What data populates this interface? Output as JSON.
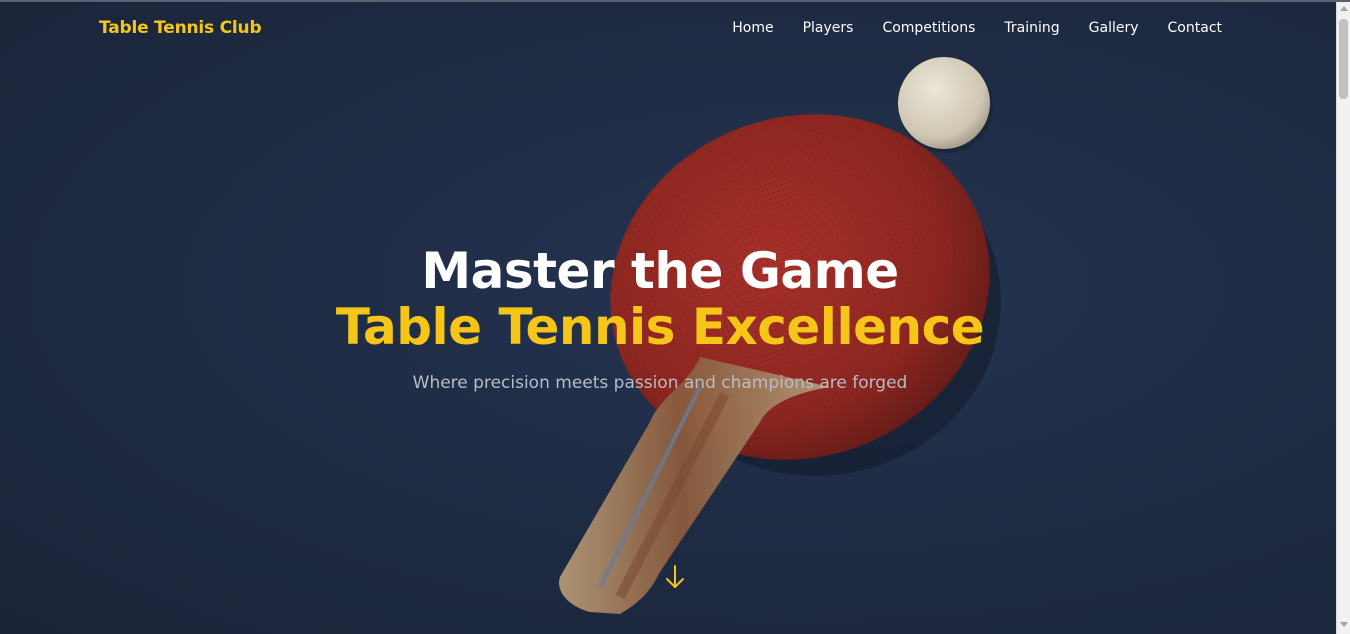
{
  "brand": {
    "name": "Table Tennis Club"
  },
  "nav": {
    "items": [
      {
        "label": "Home"
      },
      {
        "label": "Players"
      },
      {
        "label": "Competitions"
      },
      {
        "label": "Training"
      },
      {
        "label": "Gallery"
      },
      {
        "label": "Contact"
      }
    ]
  },
  "hero": {
    "title_line1": "Master the Game",
    "title_line2": "Table Tennis Excellence",
    "tagline": "Where precision meets passion and champions are forged",
    "scroll_icon": "arrow-down-icon",
    "background_image": "paddle-and-ball-photo"
  },
  "colors": {
    "accent": "#f5c518",
    "background": "#1e2a3f",
    "text": "#ffffff",
    "muted_text": "#b8bcc6"
  }
}
